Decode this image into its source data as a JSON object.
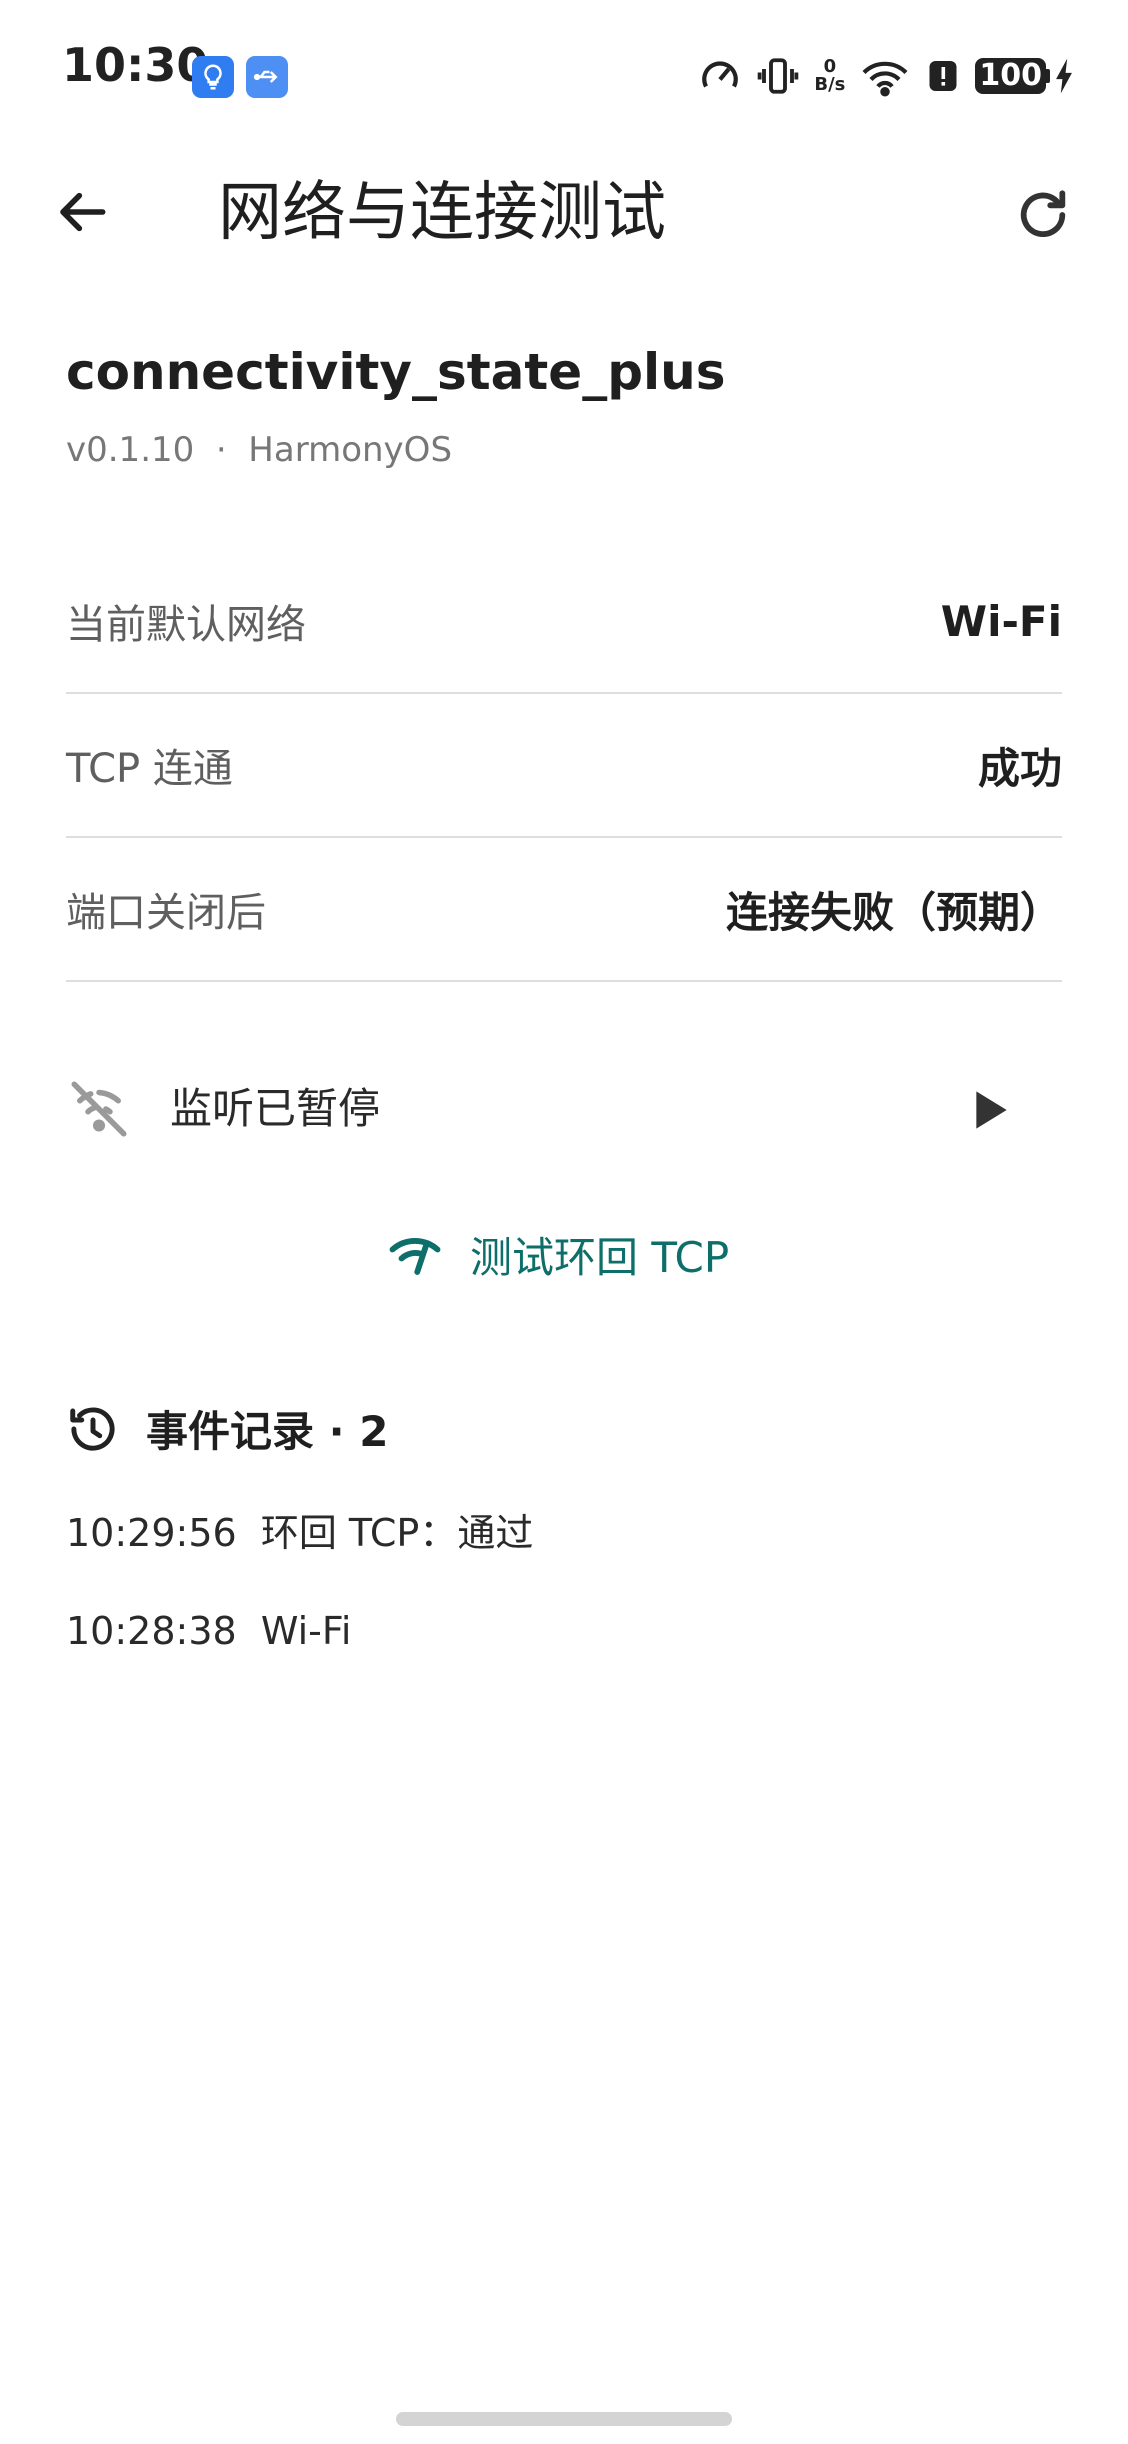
{
  "status_bar": {
    "time": "10:30",
    "net_speed_value": "0",
    "net_speed_unit": "B/s",
    "battery": "100"
  },
  "app_bar": {
    "title": "网络与连接测试"
  },
  "plugin": {
    "name": "connectivity_state_plus",
    "meta": "v0.1.10  ·  HarmonyOS"
  },
  "info_rows": [
    {
      "label": "当前默认网络",
      "value": "Wi-Fi"
    },
    {
      "label": "TCP 连通",
      "value": "成功"
    },
    {
      "label": "端口关闭后",
      "value": "连接失败（预期）"
    }
  ],
  "listener": {
    "status": "监听已暂停"
  },
  "test_button": {
    "label": "测试环回 TCP"
  },
  "event_log": {
    "title": "事件记录 · 2",
    "items": [
      "10:29:56  环回 TCP：通过",
      "10:28:38  Wi-Fi"
    ]
  },
  "colors": {
    "accent": "#0d6e6a",
    "notification": "#2f7df0"
  }
}
